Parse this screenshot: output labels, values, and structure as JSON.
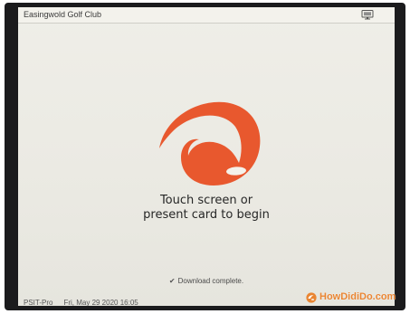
{
  "header": {
    "club_name": "Easingwold Golf Club",
    "monitor_icon": "monitor-icon"
  },
  "main": {
    "logo_icon": "swoosh-logo-icon",
    "prompt_line1": "Touch screen or",
    "prompt_line2": "present card to begin",
    "download_status": "Download complete."
  },
  "footer": {
    "product": "PSIT-Pro",
    "datetime": "Fri, May 29 2020 16:05"
  },
  "watermark": {
    "text": "HowDidiDo.com"
  },
  "colors": {
    "logo_orange": "#e8582e",
    "watermark_orange": "#e98532",
    "screen_bg": "#ecebe4",
    "bezel": "#1b1b1d"
  }
}
